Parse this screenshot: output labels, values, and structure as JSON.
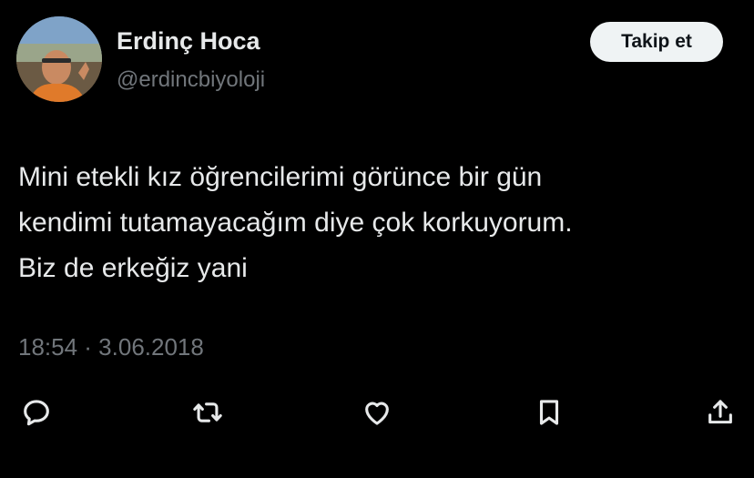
{
  "user": {
    "display_name": "Erdinç Hoca",
    "handle": "@erdincbiyoloji"
  },
  "follow_button": {
    "label": "Takip et"
  },
  "tweet": {
    "lines": [
      "Mini etekli kız öğrencilerimi görünce bir gün",
      "kendimi tutamayacağım diye çok korkuyorum.",
      "Biz de erkeğiz yani"
    ],
    "timestamp": "18:54 · 3.06.2018"
  },
  "actions": {
    "icons": [
      "reply-icon",
      "retweet-icon",
      "like-icon",
      "bookmark-icon",
      "share-icon"
    ]
  },
  "colors": {
    "background": "#000000",
    "primary_text": "#e7e9ea",
    "secondary_text": "#71767b",
    "button_bg": "#eff3f4",
    "button_text": "#0f1419"
  }
}
